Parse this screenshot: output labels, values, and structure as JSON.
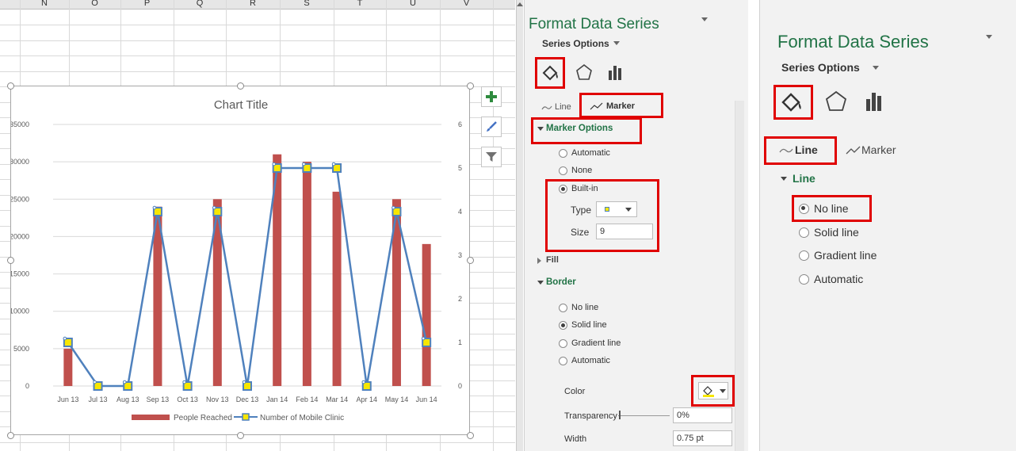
{
  "sheet": {
    "columns": [
      "N",
      "O",
      "P",
      "Q",
      "R",
      "S",
      "T",
      "U",
      "V"
    ]
  },
  "chart": {
    "title": "Chart Title",
    "legend": {
      "bar_label": "People Reached",
      "line_label": "Number of Mobile Clinic"
    },
    "side_buttons": [
      "plus-icon",
      "paintbrush-icon",
      "filter-icon"
    ]
  },
  "chart_data": {
    "type": "bar",
    "categories": [
      "Jun 13",
      "Jul 13",
      "Aug 13",
      "Sep 13",
      "Oct 13",
      "Nov 13",
      "Dec 13",
      "Jan 14",
      "Feb 14",
      "Mar 14",
      "Apr 14",
      "May 14",
      "Jun 14"
    ],
    "series": [
      {
        "name": "People Reached",
        "type": "bar",
        "axis": "primary",
        "color": "#c0504d",
        "values": [
          5000,
          0,
          0,
          24000,
          0,
          25000,
          0,
          31000,
          30000,
          26000,
          0,
          25000,
          19000
        ]
      },
      {
        "name": "Number of Mobile Clinic",
        "type": "line",
        "axis": "secondary",
        "color": "#4f81bd",
        "values": [
          1,
          0,
          0,
          4,
          0,
          4,
          0,
          5,
          5,
          5,
          0,
          4,
          1
        ]
      }
    ],
    "y_ticks": [
      "0",
      "5000",
      "10000",
      "15000",
      "20000",
      "25000",
      "30000",
      "35000"
    ],
    "y2_ticks": [
      "0",
      "1",
      "2",
      "3",
      "4",
      "5",
      "6"
    ],
    "ylim": [
      0,
      35000
    ],
    "y2lim": [
      0,
      6
    ],
    "grid": true,
    "legend_position": "bottom"
  },
  "pane1": {
    "title": "Format Data Series",
    "series_options": "Series Options",
    "tab_line": "Line",
    "tab_marker": "Marker",
    "marker_options_header": "Marker Options",
    "marker_radios": [
      "Automatic",
      "None",
      "Built-in"
    ],
    "marker_selected": "Built-in",
    "type_label": "Type",
    "size_label": "Size",
    "size_value": "9",
    "fill_header": "Fill",
    "border_header": "Border",
    "border_radios": [
      "No line",
      "Solid line",
      "Gradient line",
      "Automatic"
    ],
    "border_selected": "Solid line",
    "color_label": "Color",
    "transparency_label": "Transparency",
    "transparency_value": "0%",
    "width_label": "Width",
    "width_value": "0.75 pt",
    "marker_color": "#f7e600"
  },
  "pane2": {
    "title": "Format Data Series",
    "series_options": "Series Options",
    "tab_line": "Line",
    "tab_marker": "Marker",
    "line_header": "Line",
    "line_radios": [
      "No line",
      "Solid line",
      "Gradient line",
      "Automatic"
    ],
    "line_selected": "No line"
  },
  "colors": {
    "accent_green": "#217346",
    "highlight_red": "#e00000",
    "bar_red": "#c0504d",
    "line_blue": "#4f81bd"
  }
}
